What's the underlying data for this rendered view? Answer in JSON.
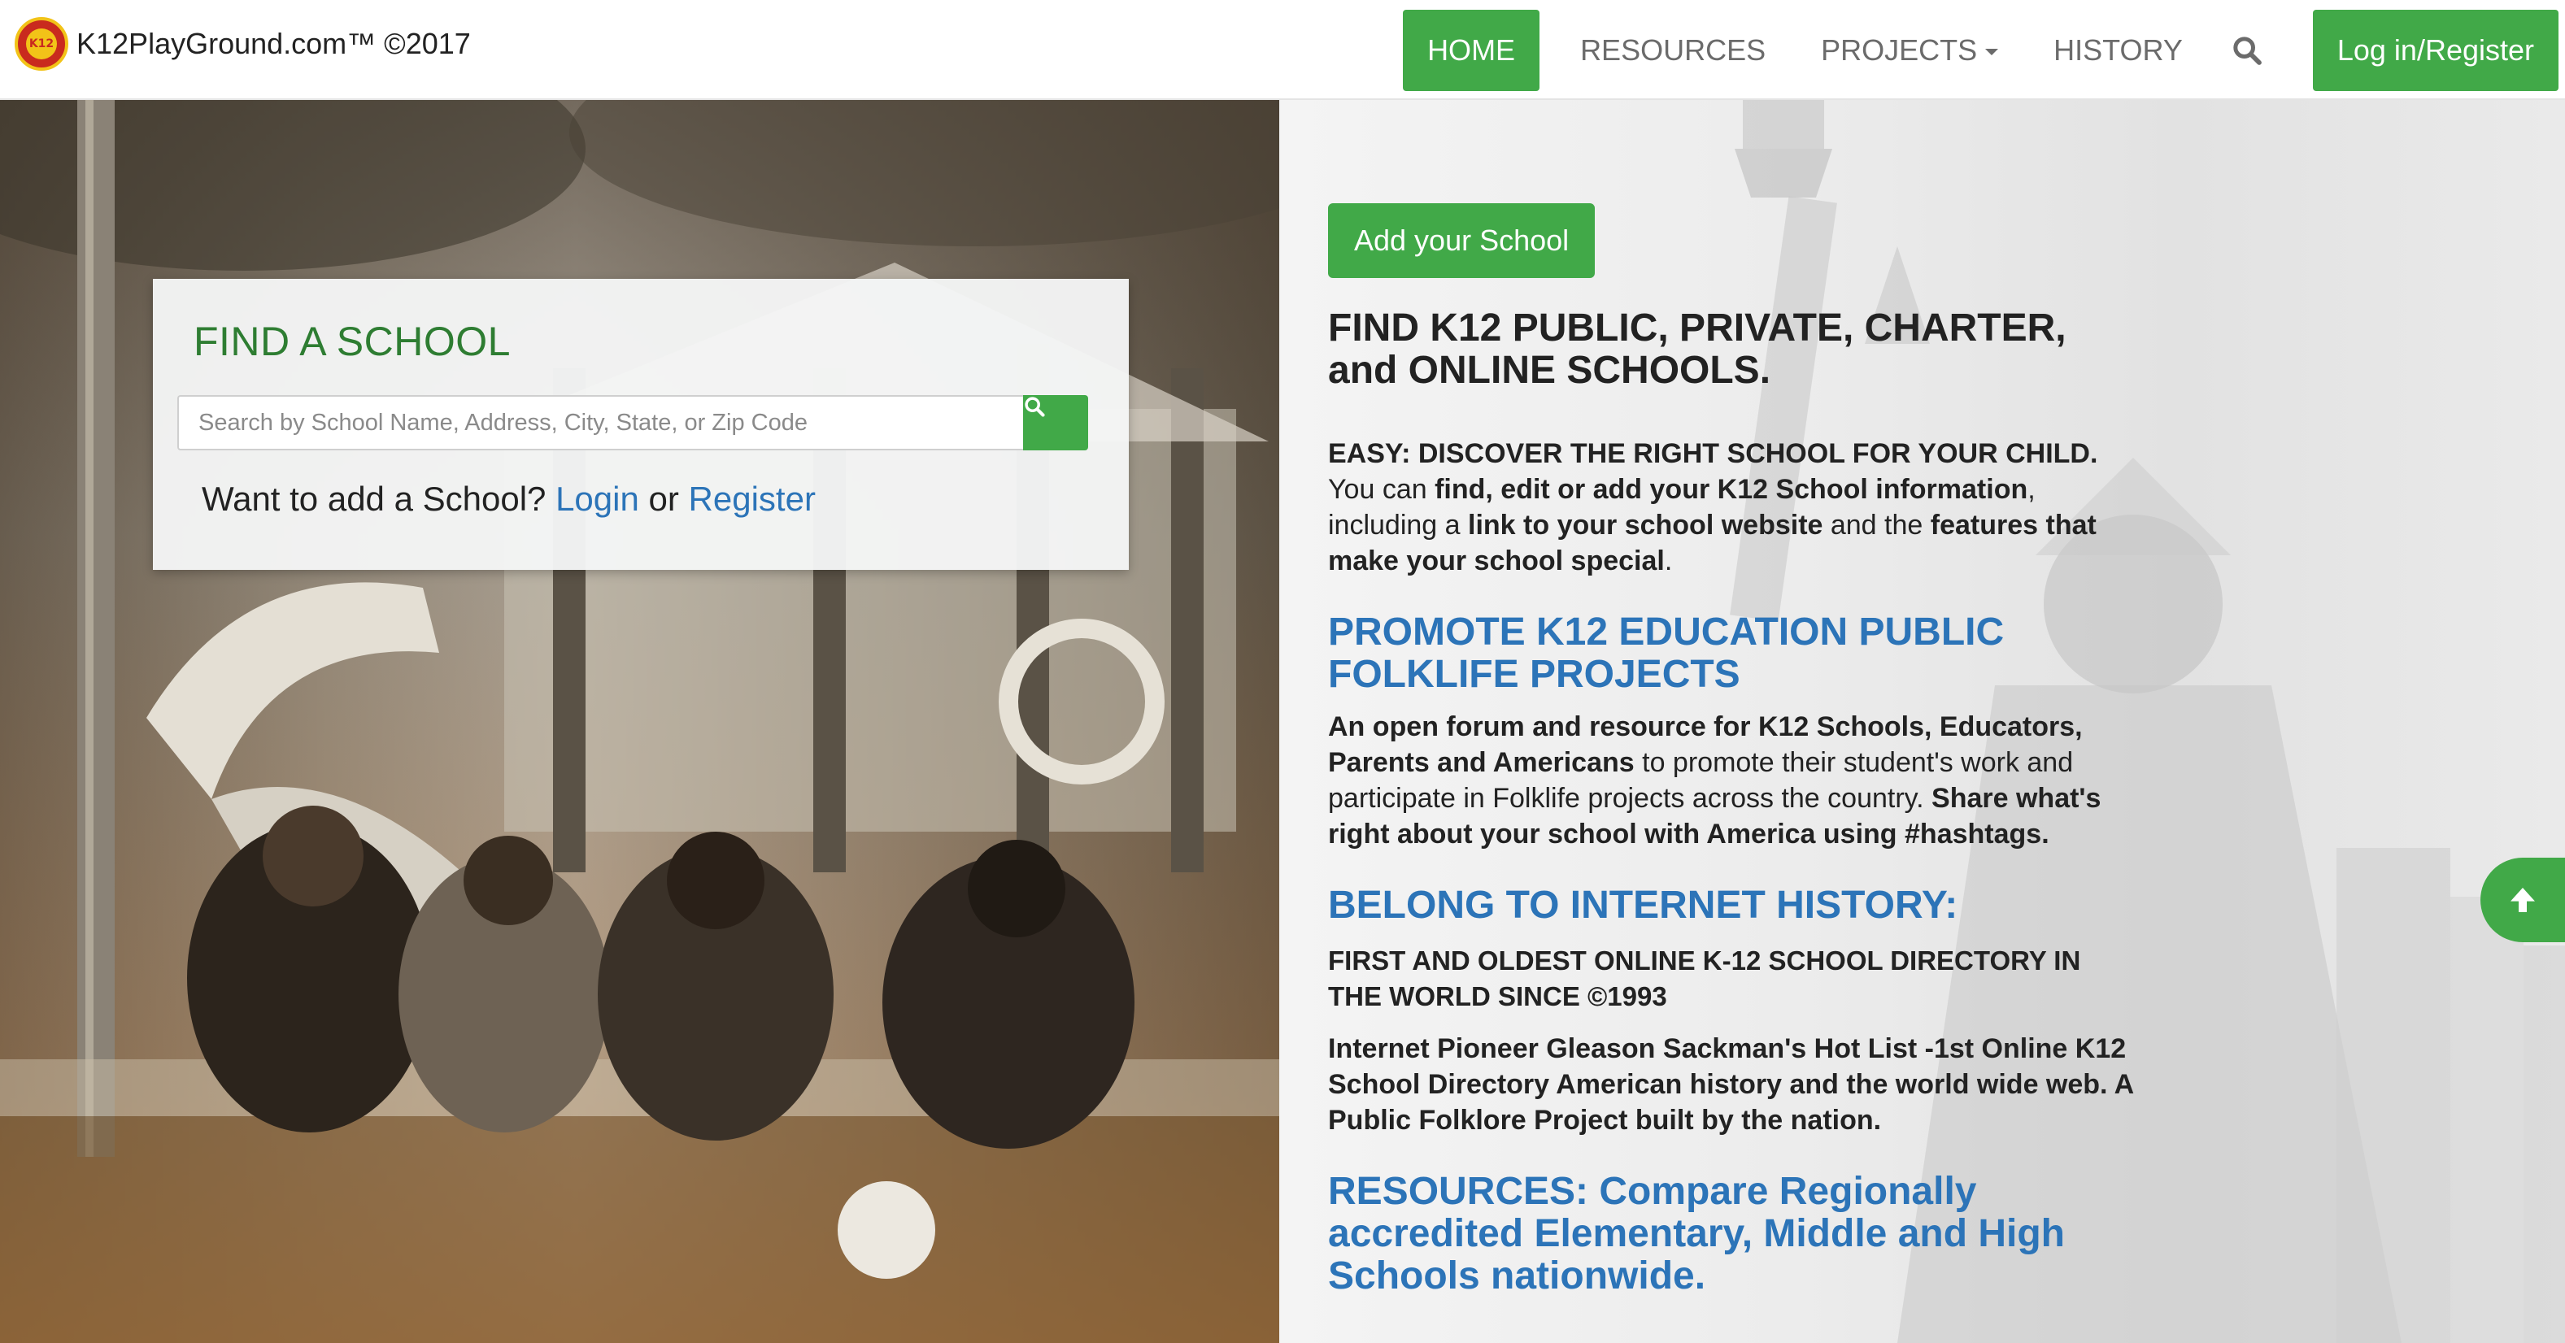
{
  "brand": {
    "text": "K12PlayGround.com™ ©2017",
    "logo_text": "K12"
  },
  "nav": {
    "items": [
      {
        "label": "HOME",
        "active": true
      },
      {
        "label": "RESOURCES"
      },
      {
        "label": "PROJECTS"
      },
      {
        "label": "HISTORY"
      }
    ],
    "search_icon": "search-icon",
    "login_label": "Log in/Register"
  },
  "find": {
    "title": "FIND A SCHOOL",
    "placeholder": "Search by School Name, Address, City, State, or Zip Code",
    "add_prefix": "Want to add a School?",
    "login_link": "Login",
    "or": "or",
    "register_link": "Register"
  },
  "right": {
    "add_button": "Add your School",
    "heading1": "FIND K12 PUBLIC, PRIVATE, CHARTER, and ONLINE SCHOOLS.",
    "easy": {
      "b1": "EASY: DISCOVER THE RIGHT SCHOOL FOR YOUR CHILD.",
      "t1": " You can ",
      "b2": "find, edit or add your K12 School information",
      "t2": ", including a ",
      "b3": "link to your school website",
      "t3": " and the ",
      "b4": "features that make your school special",
      "t4": "."
    },
    "heading2": "PROMOTE K12 EDUCATION PUBLIC FOLKLIFE PROJECTS",
    "forum": {
      "b1": "An open forum and resource for K12 Schools, Educators, Parents and Americans",
      "t1": " to promote their student's work and participate in Folklife projects across the country. ",
      "b2": "Share what's right about your school with America using #hashtags."
    },
    "heading3": "BELONG TO INTERNET HISTORY:",
    "first_oldest": "FIRST AND OLDEST ONLINE K-12 SCHOOL DIRECTORY IN THE WORLD SINCE ©1993",
    "pioneer": "Internet Pioneer Gleason Sackman's Hot List -1st Online K12 School Directory American history and the world wide web. A Public Folklore Project built by the nation.",
    "heading4": "RESOURCES: Compare Regionally accredited Elementary, Middle and High Schools nationwide."
  },
  "colors": {
    "green": "#41a948",
    "blue": "#2c74b8",
    "dark_green": "#2e7d32"
  }
}
